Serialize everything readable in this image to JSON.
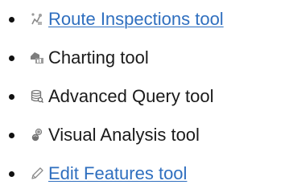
{
  "tools": [
    {
      "label": "Route Inspections tool",
      "icon": "route-inspections-icon",
      "link": true
    },
    {
      "label": "Charting tool",
      "icon": "charting-icon",
      "link": false
    },
    {
      "label": "Advanced Query tool",
      "icon": "advanced-query-icon",
      "link": false
    },
    {
      "label": "Visual Analysis tool",
      "icon": "visual-analysis-icon",
      "link": false
    },
    {
      "label": "Edit Features tool",
      "icon": "edit-features-icon",
      "link": true
    }
  ],
  "colors": {
    "link": "#2f6fbf",
    "text": "#1a1a1a",
    "bullet": "#111111"
  }
}
